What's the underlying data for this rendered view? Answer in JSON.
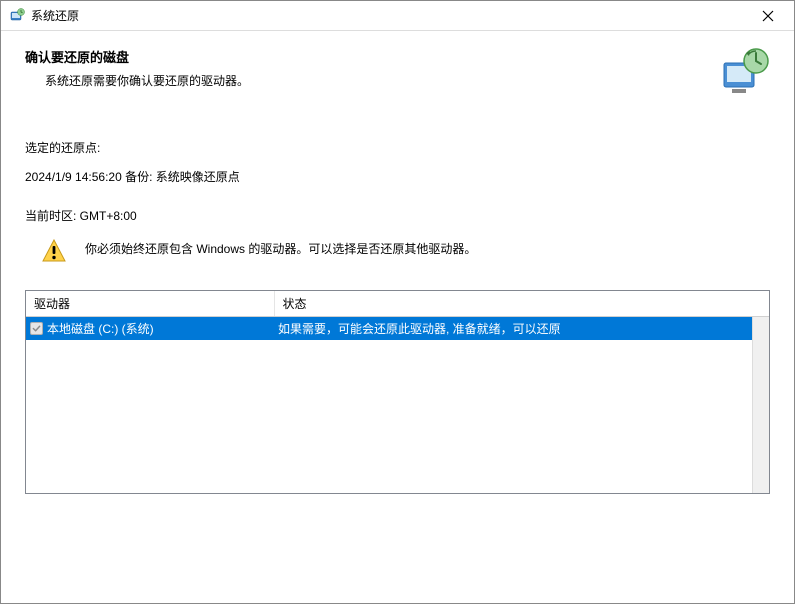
{
  "titlebar": {
    "title": "系统还原"
  },
  "header": {
    "title": "确认要还原的磁盘",
    "subtitle": "系统还原需要你确认要还原的驱动器。"
  },
  "content": {
    "selected_label": "选定的还原点:",
    "restore_point": "2024/1/9 14:56:20 备份: 系统映像还原点",
    "timezone": "当前时区: GMT+8:00",
    "warning": "你必须始终还原包含 Windows 的驱动器。可以选择是否还原其他驱动器。"
  },
  "table": {
    "headers": {
      "drive": "驱动器",
      "status": "状态"
    },
    "rows": [
      {
        "drive": "本地磁盘 (C:) (系统)",
        "status": "如果需要，可能会还原此驱动器, 准备就绪，可以还原"
      }
    ]
  }
}
